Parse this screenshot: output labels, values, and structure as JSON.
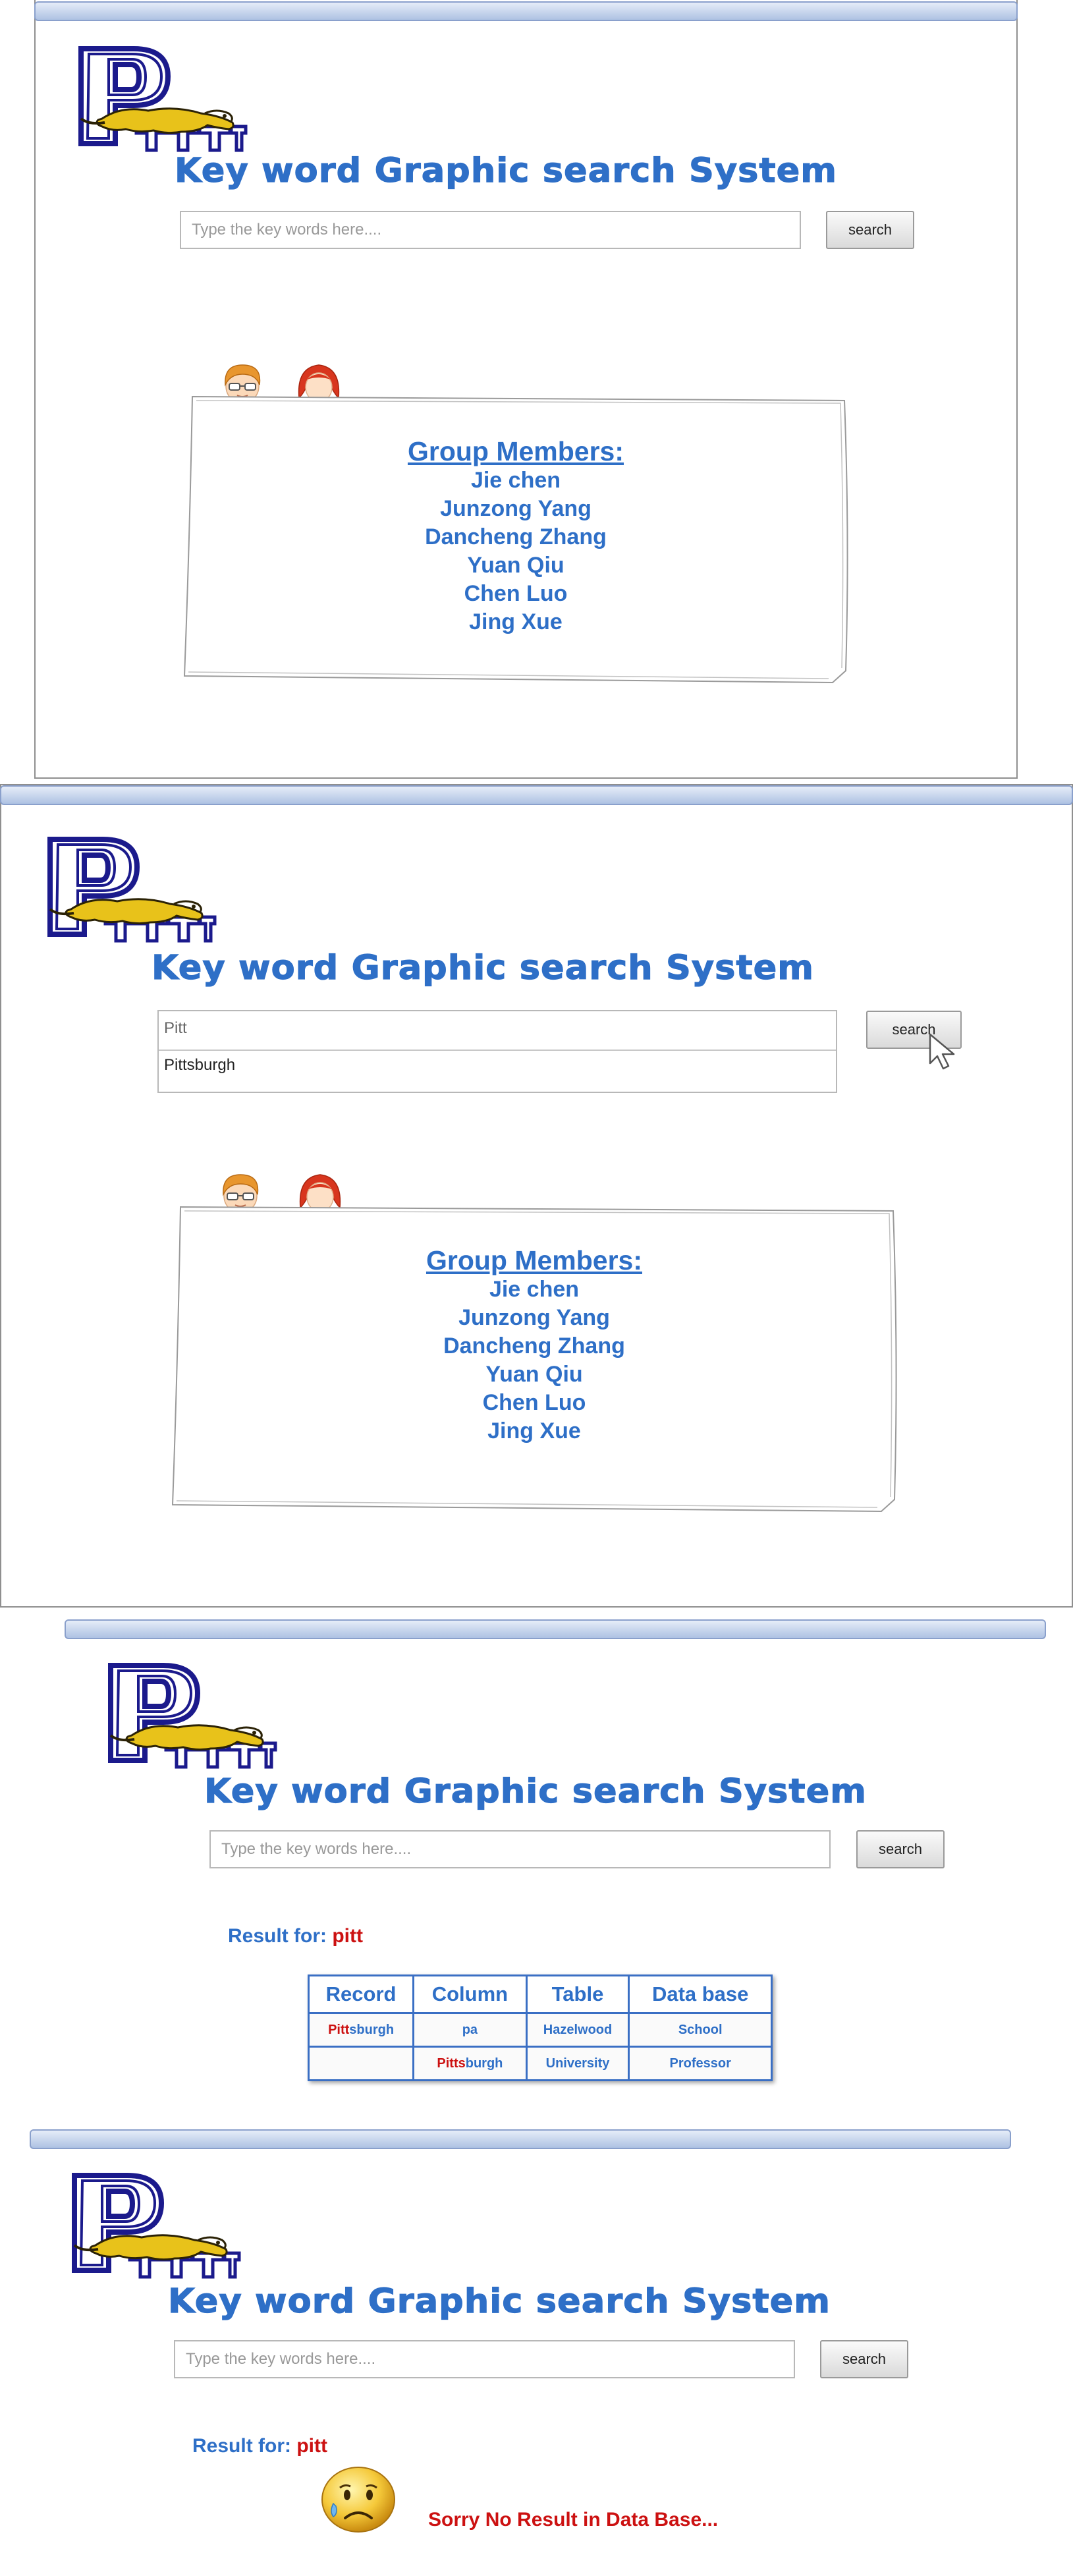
{
  "app": {
    "title": "Key word Graphic search System",
    "logo_letters": "PITTT",
    "search_placeholder": "Type the key words here....",
    "search_button": "search"
  },
  "colors": {
    "title_blue": "#2e6fc7",
    "logo_navy": "#1b1a8c",
    "panther_gold": "#e8c21a",
    "highlight_red": "#cc1111"
  },
  "members_card": {
    "heading": "Group Members:",
    "names": [
      "Jie chen",
      "Junzong Yang",
      "Dancheng Zhang",
      "Yuan Qiu",
      "Chen Luo",
      "Jing Xue"
    ]
  },
  "screen2": {
    "search_value": "Pitt",
    "suggestion": "Pittsburgh"
  },
  "results": {
    "label": "Result for:",
    "keyword": "pitt",
    "columns": [
      "Record",
      "Column",
      "Table",
      "Data base"
    ],
    "rows": [
      [
        {
          "hl": "Pitt",
          "rest": "sburgh"
        },
        {
          "hl": "",
          "rest": "pa"
        },
        {
          "hl": "",
          "rest": "Hazelwood"
        },
        {
          "hl": "",
          "rest": "School"
        }
      ],
      [
        {
          "hl": "",
          "rest": ""
        },
        {
          "hl": "Pitts",
          "rest": "burgh"
        },
        {
          "hl": "",
          "rest": "University"
        },
        {
          "hl": "",
          "rest": "Professor"
        }
      ]
    ]
  },
  "no_result": {
    "label": "Result for:",
    "keyword": "pitt",
    "message": "Sorry No Result in Data Base..."
  }
}
